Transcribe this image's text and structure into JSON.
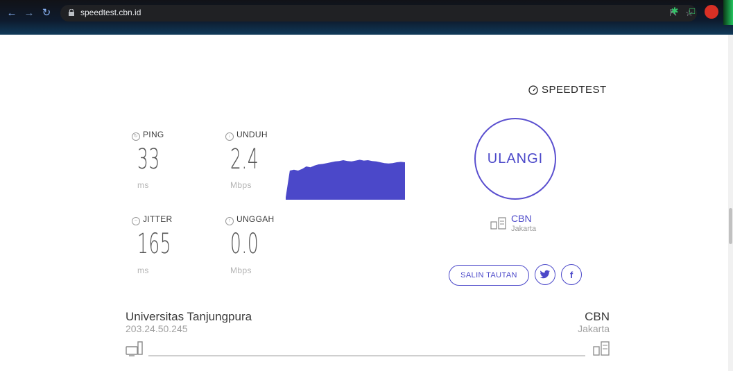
{
  "browser": {
    "url": "speedtest.cbn.id",
    "nav_icons": [
      "back-arrow-icon",
      "forward-arrow-icon",
      "reload-icon"
    ],
    "toolbar_icons": [
      "share-icon",
      "star-icon",
      "extensions-puzzle-icon",
      "sidebar-icon",
      "profile-avatar-icon"
    ]
  },
  "brand": {
    "text": "SPEEDTEST",
    "icon": "gauge-icon"
  },
  "metrics": {
    "ping": {
      "label": "PING",
      "value": "33",
      "unit": "ms",
      "icon": "ping-icon"
    },
    "unduh": {
      "label": "UNDUH",
      "value": "2.4",
      "unit": "Mbps",
      "icon": "download-icon"
    },
    "jitter": {
      "label": "JITTER",
      "value": "165",
      "unit": "ms",
      "icon": "jitter-icon"
    },
    "unggah": {
      "label": "UNGGAH",
      "value": "0.0",
      "unit": "Mbps",
      "icon": "upload-icon"
    }
  },
  "graph": {
    "color": "#4b48c9",
    "samples": [
      0.06,
      0.7,
      0.72,
      0.7,
      0.74,
      0.8,
      0.78,
      0.82,
      0.85,
      0.86,
      0.88,
      0.9,
      0.92,
      0.93,
      0.95,
      0.93,
      0.92,
      0.94,
      0.96,
      0.94,
      0.95,
      0.93,
      0.92,
      0.9,
      0.88,
      0.87,
      0.88,
      0.9,
      0.91,
      0.9
    ]
  },
  "actions": {
    "retry": "ULANGI",
    "copy_link": "SALIN TAUTAN"
  },
  "server": {
    "name": "CBN",
    "location": "Jakarta"
  },
  "connection": {
    "host_name": "Universitas Tanjungpura",
    "host_ip": "203.24.50.245",
    "dest_name": "CBN",
    "dest_location": "Jakarta"
  },
  "colors": {
    "accent": "#4b48c9"
  }
}
